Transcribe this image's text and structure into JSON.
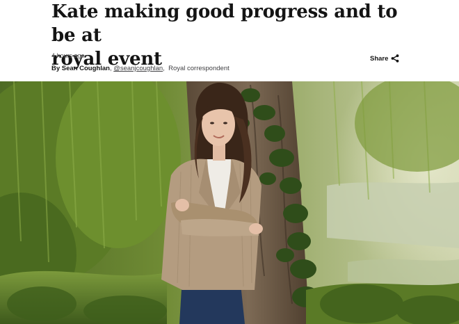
{
  "article": {
    "headline_line1": "Kate making good progress and to be at",
    "headline_line2": "royal event",
    "timestamp": "4 hours ago",
    "byline_prefix": "By ",
    "author": "Sean Coughlan",
    "handle": "@seanjcoughlan",
    "role": "Royal correspondent",
    "share_label": "Share"
  },
  "icons": {
    "share": "share-icon"
  },
  "colors": {
    "headline": "#141414",
    "meta": "#5a5a5a",
    "foliage": "#5f7f2c",
    "jacket": "#b49c80"
  }
}
